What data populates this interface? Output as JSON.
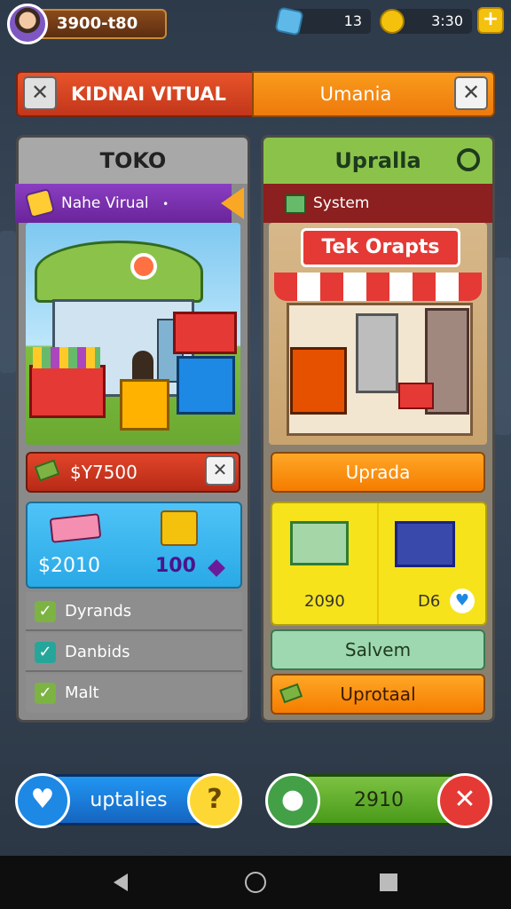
{
  "header": {
    "player_name": "3900-t80",
    "gems": "13",
    "coins": "3:30",
    "plus_label": "+"
  },
  "banner": {
    "left_title": "KIDNAI VITUAL",
    "right_title": "Umania",
    "close_label": "✕"
  },
  "left_panel": {
    "title": "TOKO",
    "ribbon_label": "Nahe Virual",
    "ribbon_dot": "•",
    "price": "$Y7500",
    "close_label": "✕",
    "stats": {
      "money": "$2010",
      "count": "100"
    },
    "checklist": [
      {
        "label": "Dyrands"
      },
      {
        "label": "Danbids"
      },
      {
        "label": "Malt"
      }
    ]
  },
  "right_panel": {
    "title": "Upralla",
    "ribbon_label": "System",
    "sign_text": "Tek Orapts",
    "upgrade_label": "Uprada",
    "cart_values": [
      "2090",
      "D6"
    ],
    "save_label": "Salvem",
    "upgrade2_label": "Uprotaal"
  },
  "bottom": {
    "left_label": "uptalies",
    "left_help": "?",
    "right_value": "2910",
    "right_close": "✕"
  },
  "colors": {
    "accent_orange": "#f57c00",
    "accent_red": "#c2361a",
    "accent_green": "#4caf50",
    "accent_blue": "#1e88e5",
    "accent_yellow": "#f6e31c"
  }
}
